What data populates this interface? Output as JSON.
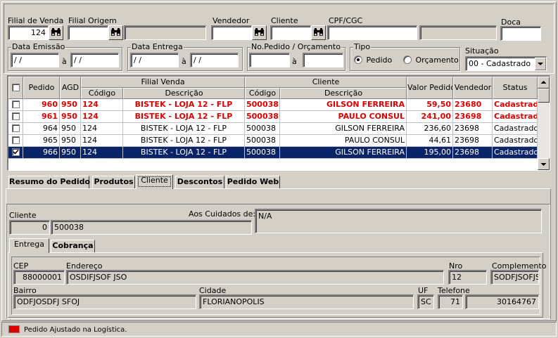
{
  "filters": {
    "filial_venda_label": "Filial de Venda",
    "filial_venda_value": "124",
    "filial_origem_label": "Filial Origem",
    "vendedor_label": "Vendedor",
    "cliente_label": "Cliente",
    "cpf_label": "CPF/CGC",
    "doca_label": "Doca",
    "data_emissao_label": "Data Emissão",
    "data_emissao_from": "/ /",
    "data_emissao_to": "/ /",
    "data_entrega_label": "Data Entrega",
    "data_entrega_from": "/ /",
    "data_entrega_to": "/ /",
    "range_sep": "à",
    "pedido_label": "No.Pedido / Orçamento",
    "tipo_label": "Tipo",
    "tipo_pedido": "Pedido",
    "tipo_orcamento": "Orçamento",
    "situacao_label": "Situação",
    "situacao_value": "00 - Cadastrado"
  },
  "grid": {
    "headers": {
      "pedido": "Pedido",
      "agd": "AGD",
      "filial_venda": "Filial Venda",
      "cliente": "Cliente",
      "codigo": "Código",
      "descricao": "Descrição",
      "valor": "Valor Pedido",
      "vendedor": "Vendedor",
      "status": "Status"
    },
    "rows": [
      {
        "pedido": "960",
        "agd": "950",
        "fcod": "124",
        "fdesc": "BISTEK - LOJA 12 - FLP",
        "ccod": "500038",
        "cdesc": "GILSON FERREIRA",
        "valor": "59,50",
        "vend": "23680",
        "status": "Cadastrado"
      },
      {
        "pedido": "961",
        "agd": "950",
        "fcod": "124",
        "fdesc": "BISTEK - LOJA 12 - FLP",
        "ccod": "500038",
        "cdesc": "PAULO CONSUL",
        "valor": "241,00",
        "vend": "23698",
        "status": "Cadastrado"
      },
      {
        "pedido": "964",
        "agd": "950",
        "fcod": "124",
        "fdesc": "BISTEK - LOJA 12 - FLP",
        "ccod": "500038",
        "cdesc": "GILSON FERREIRA",
        "valor": "236,60",
        "vend": "23698",
        "status": "Cadastrado"
      },
      {
        "pedido": "965",
        "agd": "950",
        "fcod": "124",
        "fdesc": "BISTEK - LOJA 12 - FLP",
        "ccod": "500038",
        "cdesc": "PAULO CONSUL",
        "valor": "44,61",
        "vend": "23698",
        "status": "Cadastrado"
      },
      {
        "pedido": "966",
        "agd": "950",
        "fcod": "124",
        "fdesc": "BISTEK - LOJA 12 - FLP",
        "ccod": "500038",
        "cdesc": "GILSON FERREIRA",
        "valor": "195,00",
        "vend": "23698",
        "status": "Cadastrado"
      }
    ]
  },
  "tabs": [
    "Resumo do Pedido",
    "Produtos",
    "Cliente",
    "Descontos",
    "Pedido Web"
  ],
  "cliente_tab": {
    "cliente_label": "Cliente",
    "cliente_code": "0",
    "cliente_name": "500038",
    "aos_cuidados_label": "Aos Cuidados de:",
    "aos_cuidados_value": "N/A",
    "subtabs": [
      "Entrega",
      "Cobrança"
    ],
    "cep_label": "CEP",
    "cep_value": "88000001",
    "endereco_label": "Endereço",
    "endereco_value": "OSDIFJSOF JSO",
    "nro_label": "Nro",
    "nro_value": "12",
    "complemento_label": "Complemento",
    "complemento_value": "SODFJSOFJS",
    "bairro_label": "Bairro",
    "bairro_value": "ODFJOSDFJ SFOJ",
    "cidade_label": "Cidade",
    "cidade_value": "FLORIANOPOLIS",
    "uf_label": "UF",
    "uf_value": "SC",
    "telefone_label": "Telefone",
    "ddd_value": "71",
    "telefone_value": "30164767"
  },
  "footer": {
    "legend_text": "Pedido Ajustado na Logística.",
    "legend_color": "#e00000"
  },
  "colors": {
    "selection": "#0a246a",
    "highlight_red": "#e00000"
  }
}
